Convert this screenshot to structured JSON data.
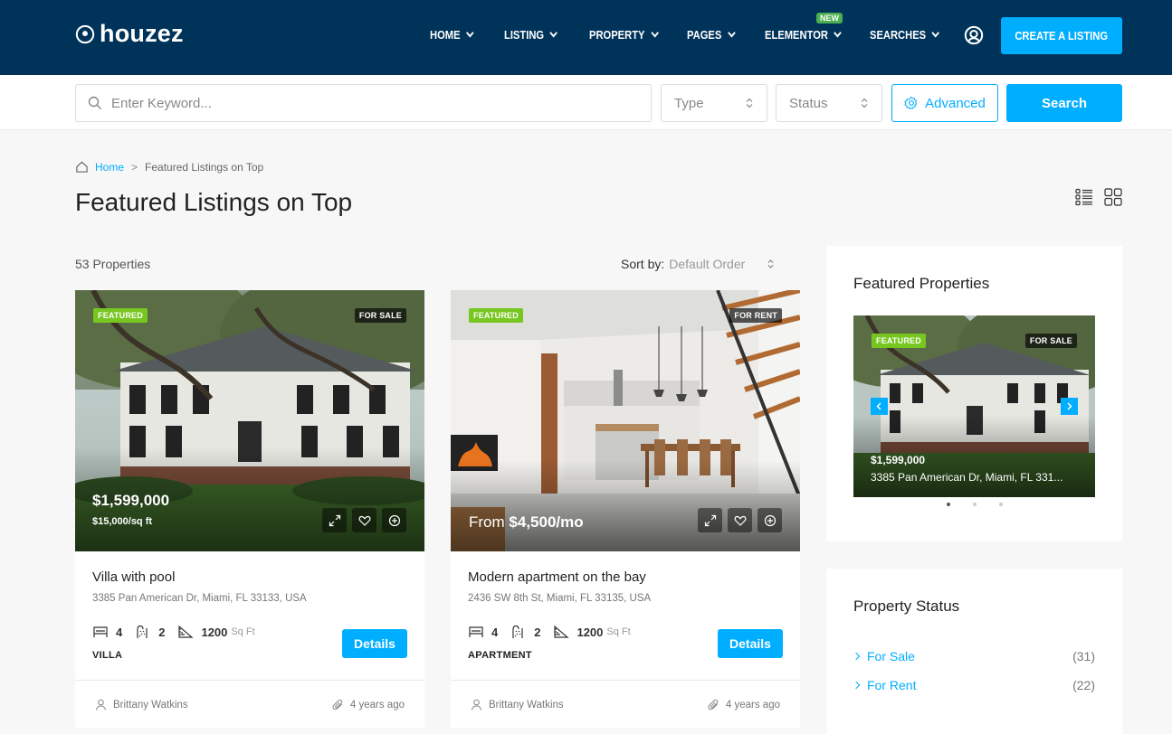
{
  "header": {
    "logo_text": "houzez",
    "nav": [
      {
        "label": "HOME"
      },
      {
        "label": "LISTING"
      },
      {
        "label": "PROPERTY"
      },
      {
        "label": "PAGES"
      },
      {
        "label": "ELEMENTOR"
      },
      {
        "label": "SEARCHES"
      }
    ],
    "new_badge": "NEW",
    "create_button": "CREATE A LISTING"
  },
  "search": {
    "keyword_placeholder": "Enter Keyword...",
    "type_label": "Type",
    "status_label": "Status",
    "advanced_label": "Advanced",
    "search_label": "Search"
  },
  "breadcrumb": {
    "home": "Home",
    "current": "Featured Listings on Top"
  },
  "page_title": "Featured Listings on Top",
  "listing": {
    "count": "53 Properties",
    "sort_label": "Sort by:",
    "sort_value": "Default Order"
  },
  "cards": [
    {
      "featured_tag": "FEATURED",
      "status_tag": "FOR SALE",
      "price": "$1,599,000",
      "price_sub": "$15,000/sq ft",
      "title": "Villa with pool",
      "address": "3385 Pan American Dr, Miami, FL 33133, USA",
      "beds": "4",
      "baths": "2",
      "area": "1200",
      "area_unit": "Sq Ft",
      "type": "VILLA",
      "details": "Details",
      "agent": "Brittany Watkins",
      "posted": "4 years ago"
    },
    {
      "featured_tag": "FEATURED",
      "status_tag": "FOR RENT",
      "price_prefix": "From",
      "price": "$4,500/mo",
      "title": "Modern apartment on the bay",
      "address": "2436 SW 8th St, Miami, FL 33135, USA",
      "beds": "4",
      "baths": "2",
      "area": "1200",
      "area_unit": "Sq Ft",
      "type": "APARTMENT",
      "details": "Details",
      "agent": "Brittany Watkins",
      "posted": "4 years ago"
    }
  ],
  "sidebar": {
    "featured_title": "Featured Properties",
    "slide": {
      "featured_tag": "FEATURED",
      "status_tag": "FOR SALE",
      "price": "$1,599,000",
      "address": "3385 Pan American Dr, Miami, FL 331..."
    },
    "status_title": "Property Status",
    "statuses": [
      {
        "label": "For Sale",
        "count": "(31)"
      },
      {
        "label": "For Rent",
        "count": "(22)"
      }
    ]
  },
  "colors": {
    "header_bg": "#00335a",
    "accent": "#00aeff",
    "featured_tag": "#77c720",
    "new_badge": "#4caf50"
  }
}
